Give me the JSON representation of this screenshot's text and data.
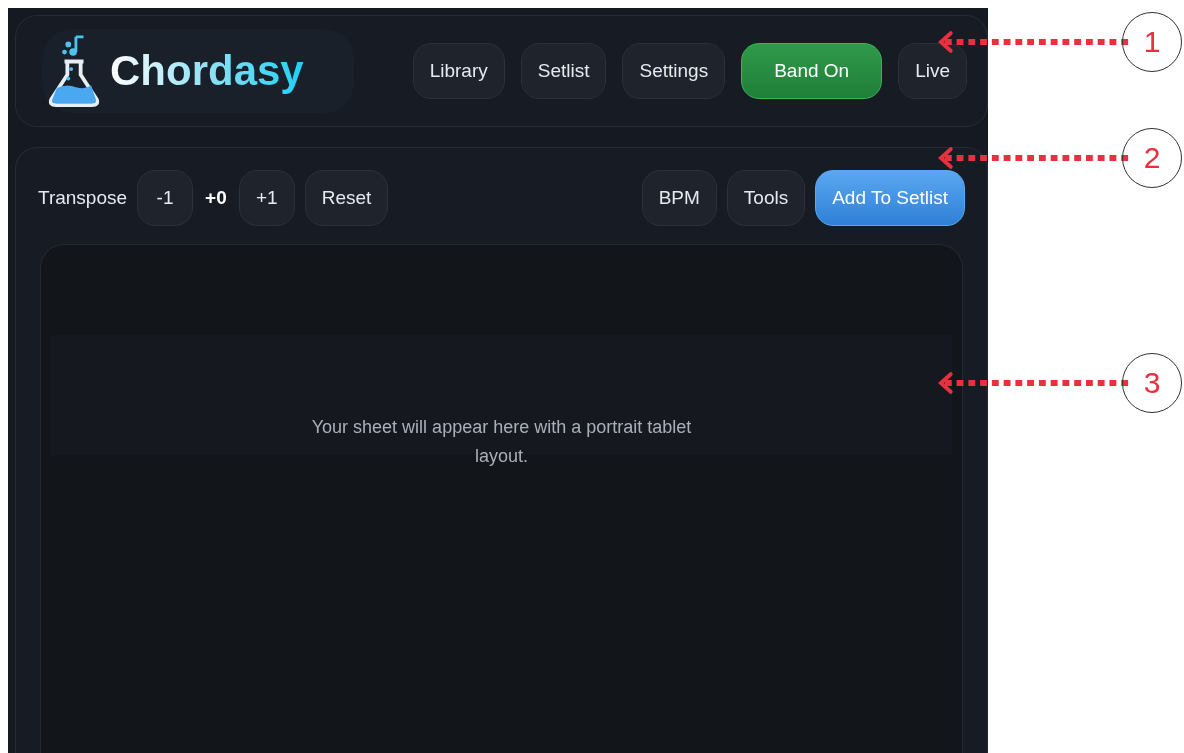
{
  "header": {
    "logo_text": "Chordasy",
    "nav": [
      {
        "label": "Library",
        "kind": "link"
      },
      {
        "label": "Setlist",
        "kind": "link"
      },
      {
        "label": "Settings",
        "kind": "link"
      },
      {
        "label": "Band On",
        "kind": "toggle",
        "on": true
      },
      {
        "label": "Live",
        "kind": "link"
      }
    ]
  },
  "toolbar": {
    "label": "Transpose",
    "value": "+0",
    "left_buttons": [
      {
        "label": "-1"
      },
      {
        "label": "+1"
      },
      {
        "label": "Reset"
      }
    ],
    "right_buttons": [
      {
        "label": "BPM",
        "primary": false
      },
      {
        "label": "Tools",
        "primary": false
      },
      {
        "label": "Add To Setlist",
        "primary": true
      }
    ]
  },
  "sheet": {
    "message": "Your sheet will appear here with a portrait tablet layout."
  },
  "annotations": [
    {
      "label": "1"
    },
    {
      "label": "2"
    },
    {
      "label": "3"
    }
  ]
}
